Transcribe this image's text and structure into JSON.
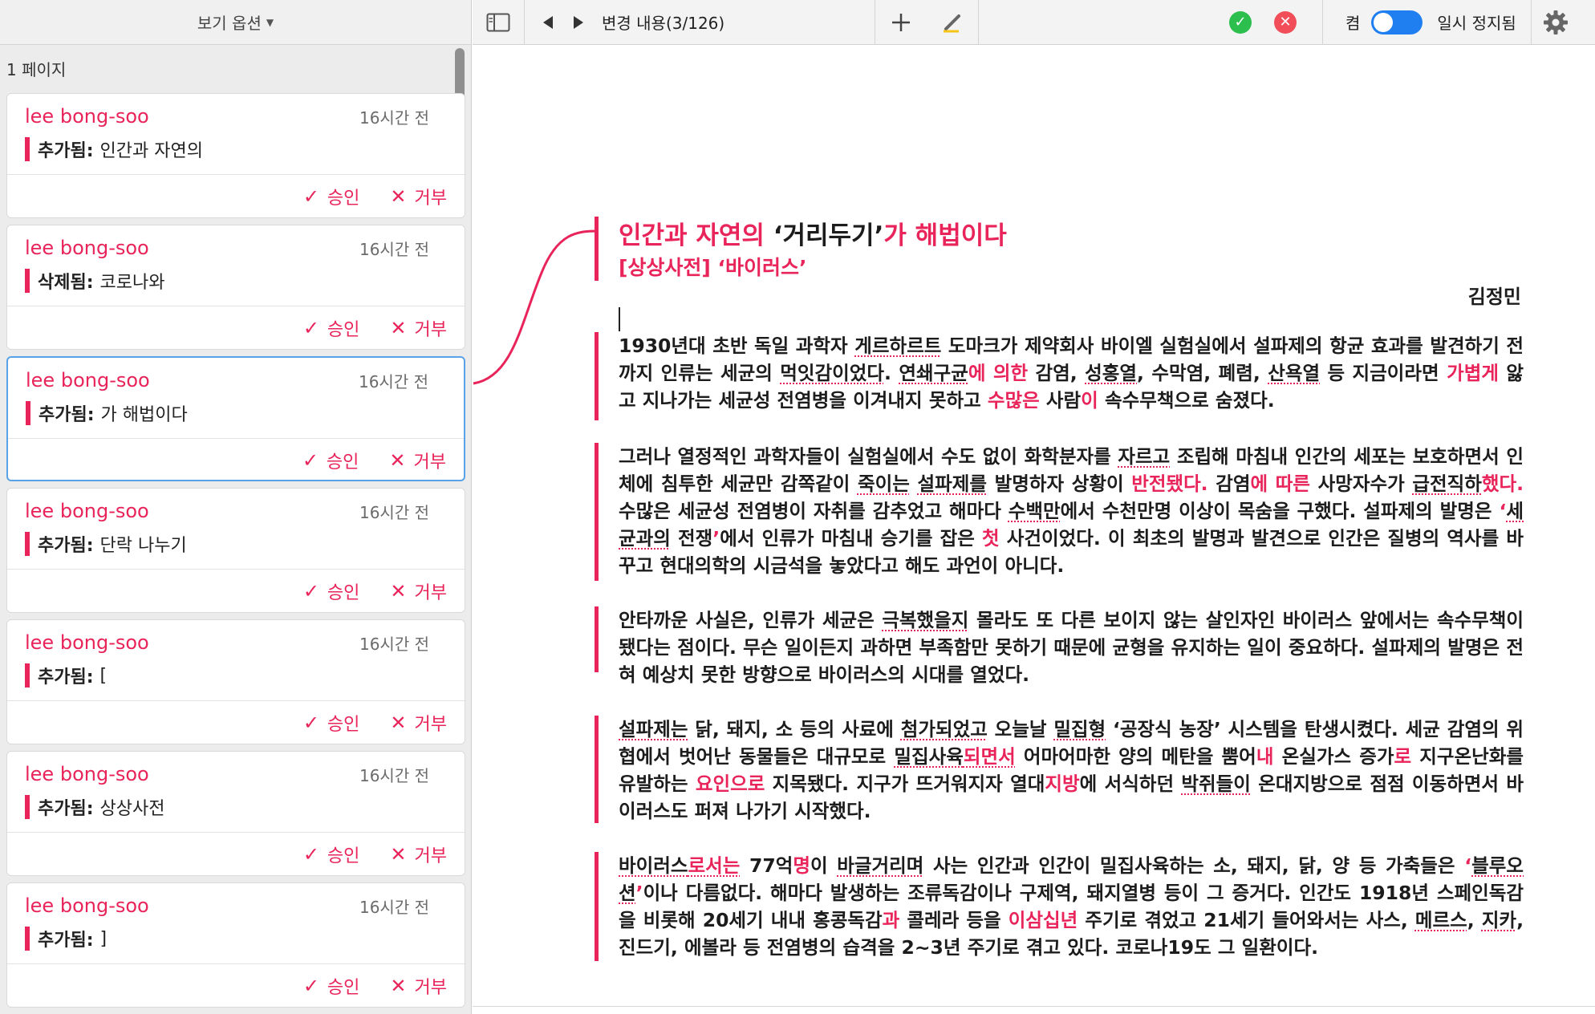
{
  "sidebar": {
    "view_options_label": "보기 옵션",
    "page_label": "1 페이지",
    "cards": [
      {
        "author": "lee bong-soo",
        "time": "16시간 전",
        "type": "추가됨:",
        "text": "인간과 자연의",
        "accept": "승인",
        "reject": "거부"
      },
      {
        "author": "lee bong-soo",
        "time": "16시간 전",
        "type": "삭제됨:",
        "text": "코로나와",
        "accept": "승인",
        "reject": "거부"
      },
      {
        "author": "lee bong-soo",
        "time": "16시간 전",
        "type": "추가됨:",
        "text": "가 해법이다",
        "accept": "승인",
        "reject": "거부"
      },
      {
        "author": "lee bong-soo",
        "time": "16시간 전",
        "type": "추가됨:",
        "text": "단락 나누기",
        "accept": "승인",
        "reject": "거부"
      },
      {
        "author": "lee bong-soo",
        "time": "16시간 전",
        "type": "추가됨:",
        "text": "[",
        "accept": "승인",
        "reject": "거부"
      },
      {
        "author": "lee bong-soo",
        "time": "16시간 전",
        "type": "추가됨:",
        "text": "상상사전",
        "accept": "승인",
        "reject": "거부"
      },
      {
        "author": "lee bong-soo",
        "time": "16시간 전",
        "type": "추가됨:",
        "text": "]",
        "accept": "승인",
        "reject": "거부"
      }
    ]
  },
  "toolbar": {
    "change_counter": "변경 내용(3/126)",
    "toggle_label": "켬",
    "pause_label": "일시 정지됨"
  },
  "colors": {
    "accent": "#e8245a",
    "accept_green": "#2dbf4e",
    "reject_red": "#f24e59",
    "toggle_blue": "#1f7ff0"
  },
  "doc": {
    "title_ins1": "인간과 자연의",
    "title_plain": " ‘거리두기’",
    "title_ins2": "가 해법이다",
    "subtitle": "[상상사전] ‘바이러스’",
    "author": "김정민",
    "p1": {
      "a": "1930년대 초반 독일 과학자 ",
      "b": "게르하르트",
      "c": " 도마크가 제약회사 바이엘 실험실에서 설파제의 항균 효과를 발견하기 전까지 인류는 세균의 ",
      "d": "먹잇감이었다",
      "e": ". ",
      "f": "연쇄구균",
      "g": "에 의한",
      "h": " 감염, ",
      "i": "성홍열",
      "j": ", 수막염, 폐렴, ",
      "k": "산욕열",
      "l": " 등 지금이라면 ",
      "m": "가볍게",
      "n": " 앓고 지나가는 세균성 전염병을 이겨내지 못하고 ",
      "o": "수많은",
      "p": " 사람",
      "q": "이",
      "r": " 속수무책으로 숨졌다."
    },
    "p2": {
      "a": "그러나 열정적인 과학자들이 실험실에서 수도 없이 화학분자를 ",
      "b": "자르고",
      "c": " 조립해 마침내 인간의 세포는 보호하면서 인체에 침투한 세균만 감쪽같이 ",
      "d": "죽이는",
      "e": " ",
      "f": "설파제를",
      "g": " 발명하자 상황이 ",
      "h": "반전됐다.",
      "i": " 감염",
      "j": "에 따른",
      "k": " 사망자수가 ",
      "l": "급전직하",
      "m": "했다.",
      "n": " 수많은 세균성 전염병이 자취를 감추었고 해마다 ",
      "o": "수백만",
      "p": "에서 수천만명 이상이 목숨을 구했다. 설파제의 발명은 ",
      "q": "‘",
      "r": "세균과의",
      "s": " 전쟁",
      "t": "’",
      "u": "에서 인류가 마침내 승기를 잡은 ",
      "v": "첫",
      "w": " 사건이었다. 이 최초의 발명과 발견으로 인간은 질병의 역사를 바꾸고 현대의학의 시금석을 놓았다고 해도 과언이 아니다."
    },
    "p3": {
      "a": "안타까운 사실은, 인류가 세균은 ",
      "b": "극복했을지",
      "c": " 몰라도 또 다른 보이지 않는 살인자인 바이러스 앞에서는 속수무책이 됐다는 점이다. 무슨 일이든지 과하면 부족함만 못하기 때문에 균형을 유지하는 일이 중요하다. 설파제의 발명은 전혀 예상치 못한 방향으로 바이러스의 시대를 열었다."
    },
    "p4": {
      "a": "",
      "b": "설파제는",
      "c": " 닭, 돼지, 소 등의 사료에 ",
      "d": "첨가되었고",
      "e": " 오늘날 ",
      "f": "밀집형",
      "g": " ‘공장식 농장’ 시스템을 탄생시켰다. 세균 감염의 위협에서 벗어난 동물들은 대규모로 ",
      "h": "밀집사육",
      "i": "되면서",
      "j": " 어마어마한 양의 메탄을 뿜어",
      "k": "내",
      "l": " 온실가스 증가",
      "m": "로",
      "n": " 지구온난화를 유발하는 ",
      "o": "요인으로",
      "p": " 지목됐다. 지구가 뜨거워지자 열대",
      "q": "지방",
      "r": "에 서식하던 ",
      "s": "박쥐들이",
      "t": " 온대지방으로 점점 이동하면서 바이러스도 퍼져 나가기 시작했다."
    },
    "p5": {
      "a": "바이러스",
      "b": "로서는",
      "c": " 77억",
      "d": "명",
      "e": "이 ",
      "f": "바글거리며",
      "g": " 사는 인간과 인간이 밀집사육하는 소, 돼지, 닭, 양 등 가축들은 ",
      "h": "‘",
      "i": "블루오션",
      "j": "’",
      "k": "이나 다름없다. 해마다 발생하는 조류독감이나 구제역, 돼지열병 등이 그 증거다. 인간도 1918년 스페인독감을 비롯해 20세기 내내 홍콩독감",
      "l": "과",
      "m": " 콜레라 등을 ",
      "n": "이삼십년",
      "o": " 주기로 겪었고 21세기 들어와서는 사스, ",
      "p": "메르스",
      "q": ", ",
      "r": "지카",
      "s": ", 진드기, 에볼라 등 전염병의 습격을 2~3년 주기로 겪고 있다. 코로나19도 그 일환이다."
    }
  }
}
